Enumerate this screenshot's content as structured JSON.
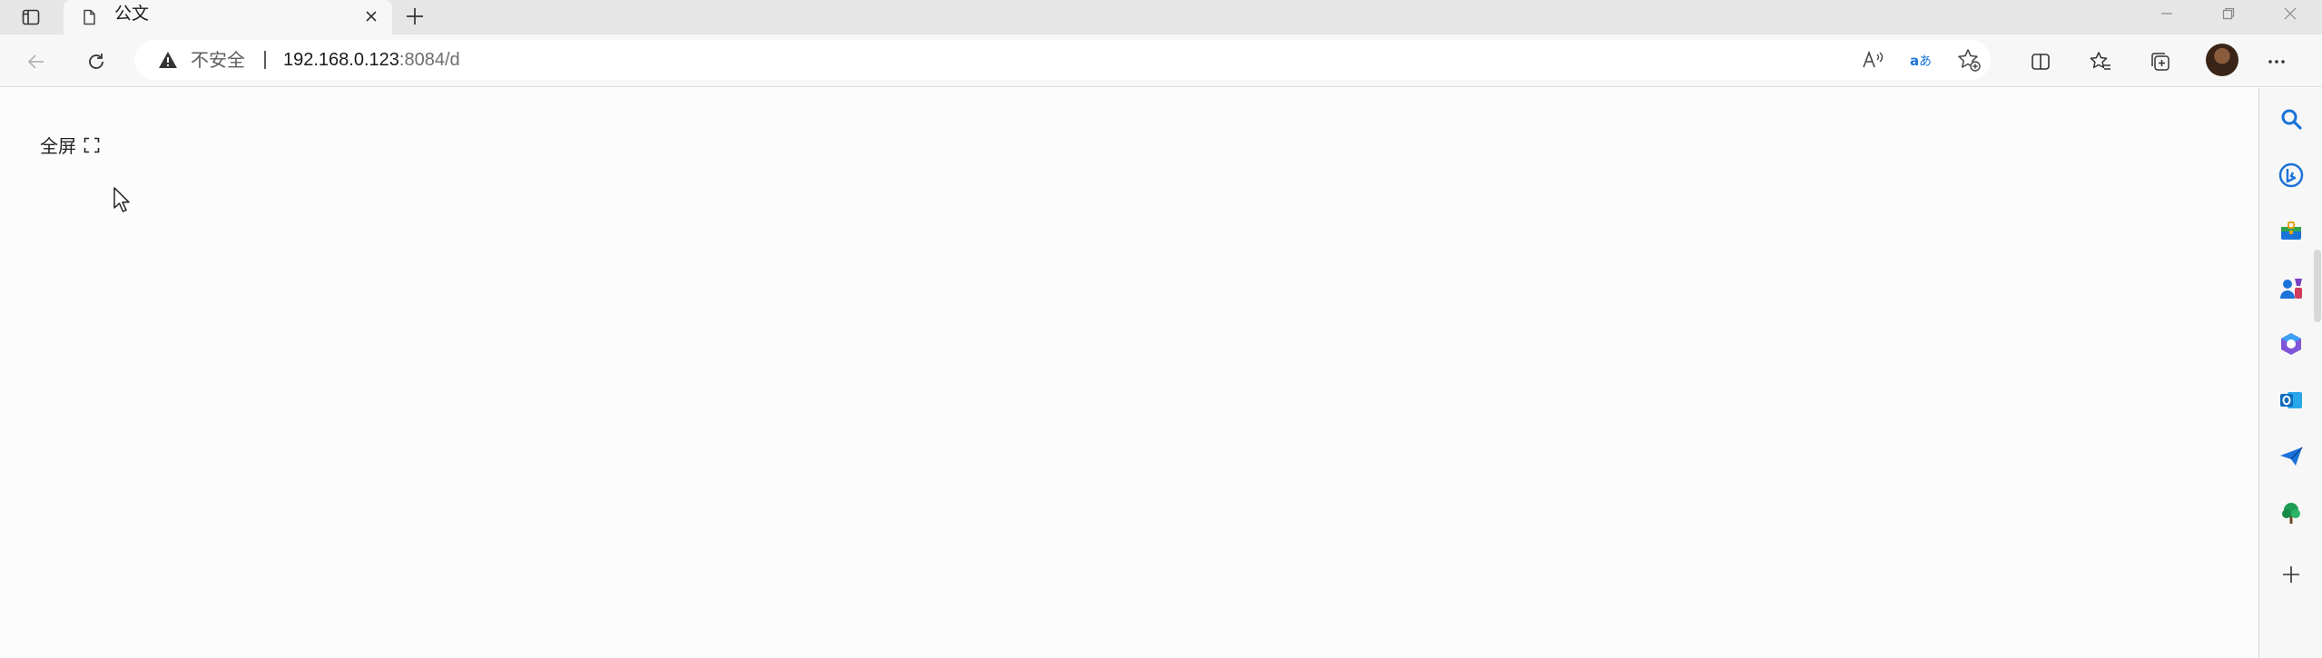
{
  "browser": {
    "tab": {
      "title": "公文",
      "favicon": "document-icon",
      "close_icon": "close-icon"
    },
    "new_tab_icon": "plus-icon",
    "window_controls": [
      "minimize-icon",
      "restore-icon",
      "close-icon"
    ],
    "toolbar": {
      "back_icon": "arrow-left-icon",
      "refresh_icon": "refresh-icon",
      "address": {
        "security_icon": "warning-icon",
        "security_text": "不安全",
        "url_host": "192.168.0.123",
        "url_path": ":8084/d"
      },
      "address_icons": [
        "read-aloud-icon",
        "translate-icon",
        "favorite-add-icon"
      ],
      "right_icons": [
        "split-screen-icon",
        "favorites-icon",
        "collections-icon",
        "profile-avatar",
        "more-icon"
      ]
    },
    "sidebar": {
      "items": [
        "search-icon",
        "bing-chat-icon",
        "shopping-icon",
        "games-icon",
        "microsoft365-icon",
        "outlook-icon",
        "send-icon",
        "tree-icon",
        "add-icon"
      ]
    }
  },
  "page": {
    "fullscreen_label": "全屏",
    "fullscreen_icon": "fullscreen-icon"
  },
  "colors": {
    "tabstrip": "#e6e6e6",
    "toolbar": "#f7f7f7",
    "page_bg": "#fcfcfc",
    "accent_blue": "#1a73d8"
  }
}
